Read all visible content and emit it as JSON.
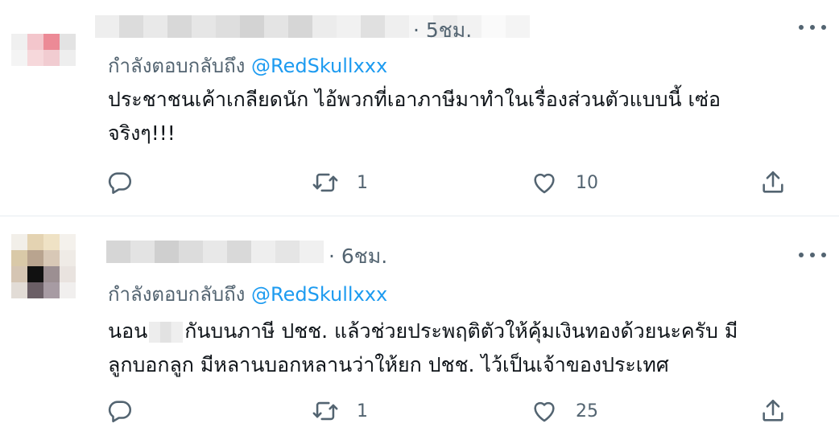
{
  "tweets": [
    {
      "time": "· 5ชม.",
      "replying_prefix": "กำลังตอบกลับถึง",
      "replying_handle": "@RedSkullxxx",
      "body_line1": "ประชาชนเค้าเกลียดนัก ไอ้พวกที่เอาภาษีมาทำในเรื่องส่วนตัวแบบนี้ เซ่อ",
      "body_line2": "จริงๆ!!!",
      "retweet_count": "1",
      "like_count": "10"
    },
    {
      "time": "· 6ชม.",
      "replying_prefix": "กำลังตอบกลับถึง",
      "replying_handle": "@RedSkullxxx",
      "body_line1_pre": "นอน",
      "body_line1_post": "กันบนภาษี ปชช. แล้วช่วยประพฤติตัวให้คุ้มเงินทองด้วยนะครับ มี",
      "body_line2": "ลูกบอกลูก มีหลานบอกหลานว่าให้ยก ปชช. ไว้เป็นเจ้าของประเทศ",
      "retweet_count": "1",
      "like_count": "25"
    }
  ],
  "colors": {
    "text": "#0f1419",
    "secondary": "#536471",
    "link": "#1d9bf0",
    "divider": "#e6ecf0"
  },
  "icons": [
    "reply-icon",
    "retweet-icon",
    "like-icon",
    "share-icon",
    "more-icon"
  ]
}
